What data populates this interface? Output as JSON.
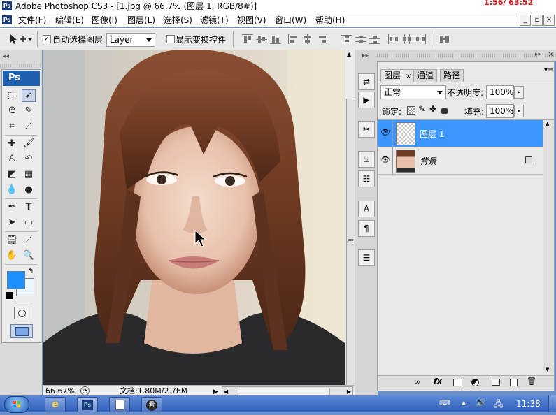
{
  "title_bar": {
    "app_icon": "Ps",
    "title": "Adobe Photoshop CS3 - [1.jpg @ 66.7% (图层 1, RGB/8#)]",
    "overlay_text": "1:56/ 63:52"
  },
  "menu_bar": {
    "app_icon": "Ps",
    "items": [
      "文件(F)",
      "编辑(E)",
      "图像(I)",
      "图层(L)",
      "选择(S)",
      "滤镜(T)",
      "视图(V)",
      "窗口(W)",
      "帮助(H)"
    ],
    "window_buttons": [
      "_",
      "▫",
      "×"
    ]
  },
  "options_bar": {
    "auto_select_label": "自动选择图层",
    "auto_select_checked": true,
    "auto_select_mode": "Layer",
    "show_transform_label": "显示变换控件",
    "show_transform_checked": false
  },
  "toolbox": {
    "logo": "Ps",
    "foreground_color": "#1e8fff",
    "background_color": "#eaf6ff"
  },
  "document": {
    "zoom": "66.67%",
    "doc_info": "文档:1.80M/2.76M"
  },
  "layers_panel": {
    "tabs": [
      "图层",
      "通道",
      "路径"
    ],
    "active_tab_close": "×",
    "blend_mode": "正常",
    "opacity_label": "不透明度:",
    "opacity_value": "100%",
    "lock_label": "锁定:",
    "fill_label": "填充:",
    "fill_value": "100%",
    "layers": [
      {
        "name": "图层 1",
        "selected": true,
        "visible": true,
        "locked": false
      },
      {
        "name": "背景",
        "selected": false,
        "visible": true,
        "locked": true
      }
    ],
    "footer_icons": [
      "link-icon",
      "fx-icon",
      "mask-icon",
      "adjustment-icon",
      "group-icon",
      "new-layer-icon",
      "trash-icon"
    ],
    "footer_fx_label": "fx"
  },
  "taskbar": {
    "clock": "11:38",
    "tasks": [
      "ie-icon",
      "photoshop-icon",
      "notepad-icon",
      "app-icon"
    ],
    "task_ps_label": "Ps",
    "task_app_label": "看"
  }
}
